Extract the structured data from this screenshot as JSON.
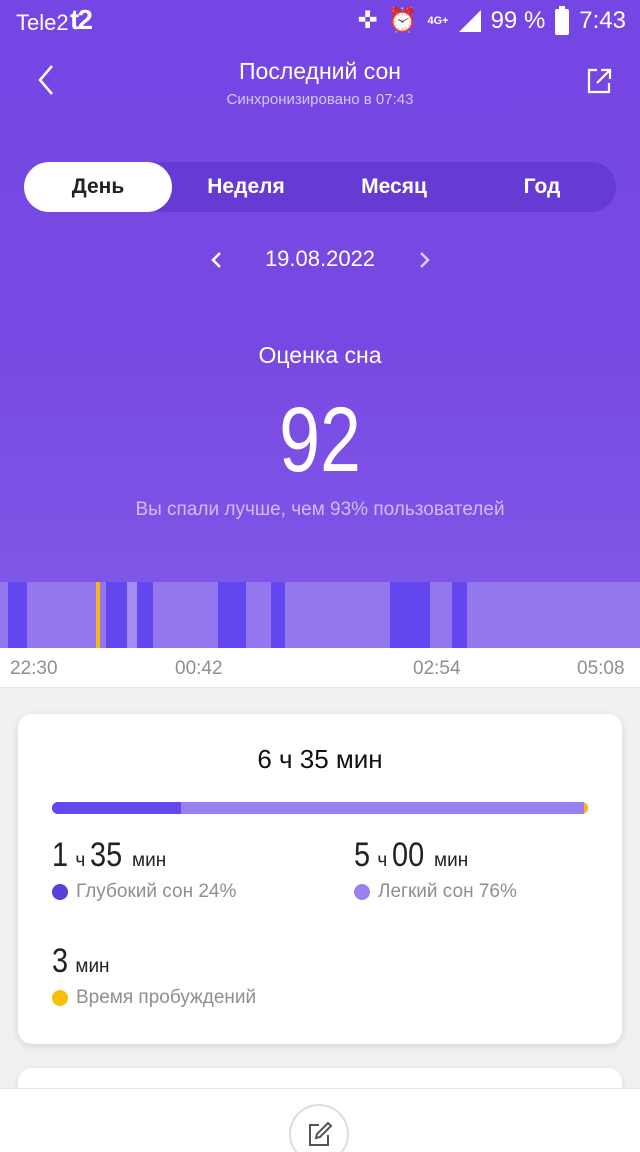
{
  "statusbar": {
    "carrier": "Tele2",
    "carrier_logo": "t2",
    "network": "4G+",
    "battery": "99 %",
    "time": "7:43",
    "icons": [
      "cross-icon",
      "alarm-icon",
      "signal-icon",
      "battery-icon"
    ]
  },
  "nav": {
    "title": "Последний сон",
    "subtitle": "Синхронизировано в 07:43",
    "back_icon": "chevron-left-icon",
    "share_icon": "share-icon"
  },
  "tabs": [
    {
      "label": "День",
      "active": true
    },
    {
      "label": "Неделя",
      "active": false
    },
    {
      "label": "Месяц",
      "active": false
    },
    {
      "label": "Год",
      "active": false
    }
  ],
  "date": {
    "value": "19.08.2022"
  },
  "score": {
    "label": "Оценка сна",
    "value": "92",
    "description": "Вы спали лучше, чем 93% пользователей"
  },
  "timeline": {
    "ticks": [
      "22:30",
      "00:42",
      "02:54",
      "05:08"
    ],
    "colors": {
      "deep": "#6448ef",
      "light": "#9476ef",
      "awake": "#f5b51c"
    }
  },
  "summary": {
    "total": "6 ч 35 мин",
    "deep_fraction": 0.24,
    "light_fraction": 0.76,
    "deep": {
      "hours": "1",
      "h_unit": "ч",
      "minutes": "35",
      "m_unit": "мин",
      "label": "Глубокий сон 24%"
    },
    "light": {
      "hours": "5",
      "h_unit": "ч",
      "minutes": "00",
      "m_unit": "мин",
      "label": "Легкий сон 76%"
    },
    "awake": {
      "minutes": "3",
      "m_unit": "мин",
      "label": "Время пробуждений"
    }
  },
  "bottom": {
    "edit_icon": "edit-icon"
  }
}
